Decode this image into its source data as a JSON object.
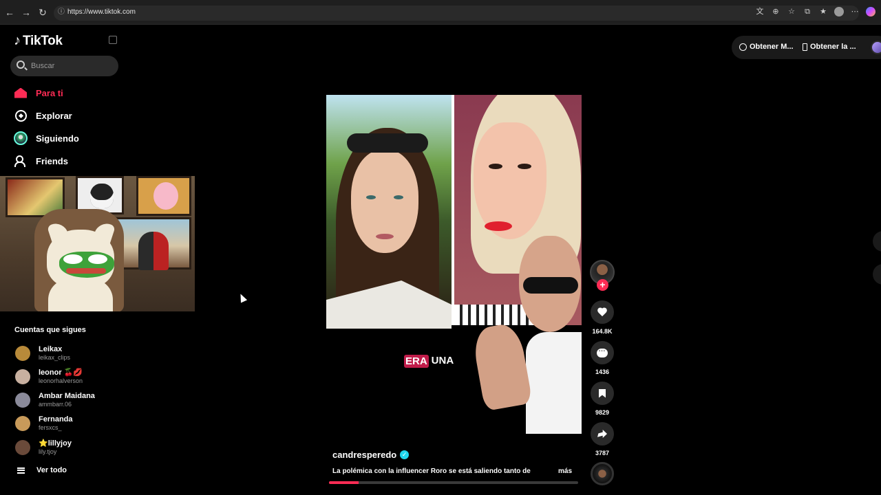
{
  "browser": {
    "url": "https://www.tiktok.com"
  },
  "sidebar": {
    "logo_text": "TikTok",
    "search_placeholder": "Buscar",
    "nav": [
      {
        "label": "Para ti",
        "active": true
      },
      {
        "label": "Explorar",
        "active": false
      },
      {
        "label": "Siguiendo",
        "active": false
      },
      {
        "label": "Friends",
        "active": false
      }
    ],
    "following_title": "Cuentas que sigues",
    "accounts": [
      {
        "name": "Leikax",
        "handle": "leikax_clips",
        "color": "#b88a3a"
      },
      {
        "name": "leonor 🍒💋",
        "handle": "leonorhalverson",
        "color": "#c8b0a0"
      },
      {
        "name": "Ambar Maidana",
        "handle": "ammbarr.06",
        "color": "#8a8a9a"
      },
      {
        "name": "Fernanda",
        "handle": "fersxcs_",
        "color": "#c89a5a"
      },
      {
        "name": "⭐lillyjoy",
        "handle": "lily.tjoy",
        "color": "#6a4a3a"
      }
    ],
    "see_all": "Ver todo"
  },
  "top_right": {
    "pill1": "Obtener M...",
    "pill2": "Obtener la ..."
  },
  "video": {
    "caption_highlight": "ERA",
    "caption_rest": "UNA",
    "author": "candresperedo",
    "description": "La polémica con la influencer Roro se está saliendo tanto de",
    "more": "más",
    "progress": 0.12
  },
  "actions": {
    "likes": "164.8K",
    "comments": "1436",
    "saves": "9829",
    "shares": "3787"
  },
  "colors": {
    "accent": "#fe2c55",
    "verified": "#20d5ec"
  }
}
